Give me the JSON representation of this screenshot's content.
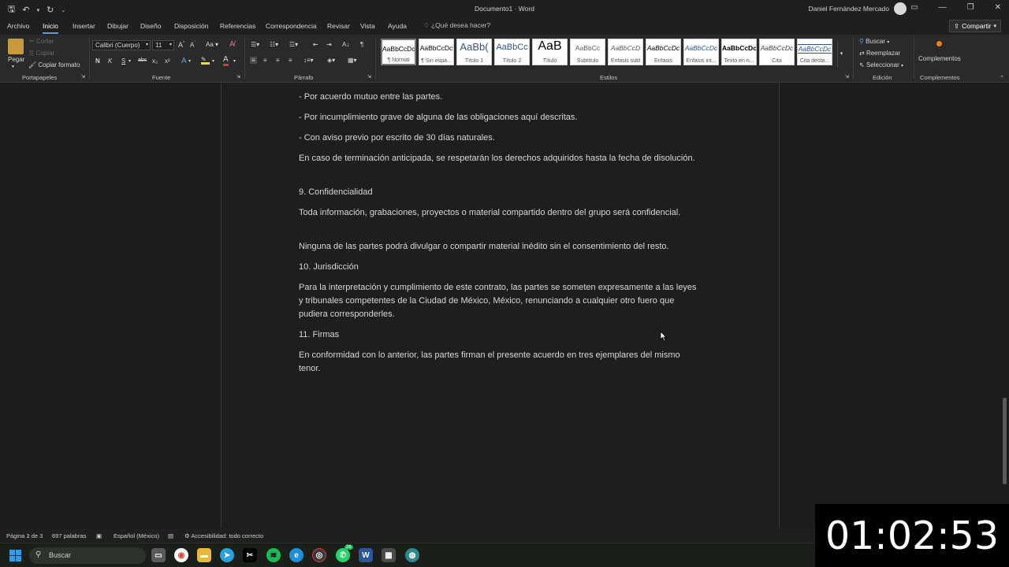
{
  "app": {
    "doc_title": "Documento1 · Word",
    "user_name": "Daniel Fernández Mercado",
    "tell_me": "¿Qué desea hacer?",
    "share_label": "Compartir"
  },
  "tabs": [
    "Archivo",
    "Inicio",
    "Insertar",
    "Dibujar",
    "Diseño",
    "Disposición",
    "Referencias",
    "Correspondencia",
    "Revisar",
    "Vista",
    "Ayuda"
  ],
  "ribbon": {
    "paste": "Pegar",
    "cut": "Cortar",
    "copy": "Copiar",
    "format_painter": "Copiar formato",
    "font_name": "Calibri (Cuerpo)",
    "font_size": "11",
    "change_case": "Aa",
    "bold": "N",
    "italic": "K",
    "underline": "S",
    "strike": "abc",
    "subscript": "x₂",
    "superscript": "x²",
    "groups": {
      "clipboard": "Portapapeles",
      "font": "Fuente",
      "paragraph": "Párrafo",
      "styles": "Estilos",
      "editing": "Edición",
      "addins": "Complementos"
    },
    "styles": [
      {
        "preview": "AaBbCcDc",
        "name": "¶ Normal"
      },
      {
        "preview": "AaBbCcDc",
        "name": "¶ Sin espa..."
      },
      {
        "preview": "AaBb(",
        "name": "Título 1"
      },
      {
        "preview": "AaBbCc",
        "name": "Título 2"
      },
      {
        "preview": "AaB",
        "name": "Título"
      },
      {
        "preview": "AaBbCc",
        "name": "Subtítulo"
      },
      {
        "preview": "AaBbCcD",
        "name": "Énfasis sutil"
      },
      {
        "preview": "AaBbCcDc",
        "name": "Énfasis"
      },
      {
        "preview": "AaBbCcDc",
        "name": "Énfasis int..."
      },
      {
        "preview": "AaBbCcDc",
        "name": "Texto en n..."
      },
      {
        "preview": "AaBbCcDc",
        "name": "Cita"
      },
      {
        "preview": "AaBbCcDc",
        "name": "Cita desta..."
      }
    ],
    "find": "Buscar",
    "replace": "Reemplazar",
    "select": "Seleccionar",
    "addins_button": "Complementos"
  },
  "document": {
    "paragraphs": [
      "- Por acuerdo mutuo entre las partes.",
      "- Por incumplimiento grave de alguna de las obligaciones aquí descritas.",
      "- Con aviso previo por escrito de 30 días naturales.",
      "En caso de terminación anticipada, se respetarán los derechos adquiridos hasta la fecha de disolución.",
      "9. Confidencialidad",
      "Toda información, grabaciones, proyectos o material compartido dentro del grupo será confidencial.",
      "Ninguna de las partes podrá divulgar o compartir material inédito sin el consentimiento del resto.",
      "10. Jurisdicción",
      "Para la interpretación y cumplimiento de este contrato, las partes se someten expresamente a las leyes y tribunales competentes de la Ciudad de México, México, renunciando a cualquier otro fuero que pudiera corresponderles.",
      "11. Firmas",
      "En conformidad con lo anterior, las partes firman el presente acuerdo en tres ejemplares del mismo tenor."
    ]
  },
  "status": {
    "page": "Página 3 de 3",
    "words": "697 palabras",
    "language": "Español (México)",
    "accessibility": "Accesibilidad: todo correcto"
  },
  "taskbar": {
    "search": "Buscar",
    "whatsapp_badge": "26"
  },
  "overlay": {
    "timer": "01:02:53"
  }
}
